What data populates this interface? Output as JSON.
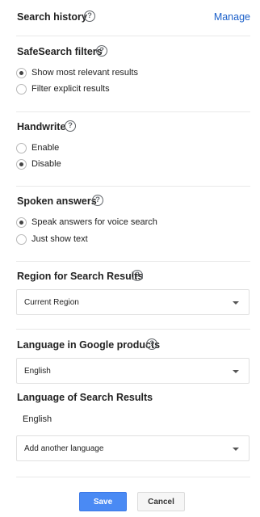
{
  "search_history": {
    "title": "Search history",
    "manage_label": "Manage"
  },
  "safesearch": {
    "title": "SafeSearch filters",
    "options": [
      {
        "label": "Show most relevant results",
        "checked": true
      },
      {
        "label": "Filter explicit results",
        "checked": false
      }
    ]
  },
  "handwrite": {
    "title": "Handwrite",
    "options": [
      {
        "label": "Enable",
        "checked": false
      },
      {
        "label": "Disable",
        "checked": true
      }
    ]
  },
  "spoken_answers": {
    "title": "Spoken answers",
    "options": [
      {
        "label": "Speak answers for voice search",
        "checked": true
      },
      {
        "label": "Just show text",
        "checked": false
      }
    ]
  },
  "region": {
    "title": "Region for Search Results",
    "selected": "Current Region"
  },
  "language_products": {
    "title": "Language in Google products",
    "selected": "English"
  },
  "language_results": {
    "title": "Language of Search Results",
    "current_language": "English",
    "add_placeholder": "Add another language"
  },
  "buttons": {
    "save_label": "Save",
    "cancel_label": "Cancel"
  },
  "help_glyph": "?",
  "colors": {
    "link": "#1a5fc9",
    "save_button": "#4a8af4",
    "divider": "#e8e8e8"
  }
}
